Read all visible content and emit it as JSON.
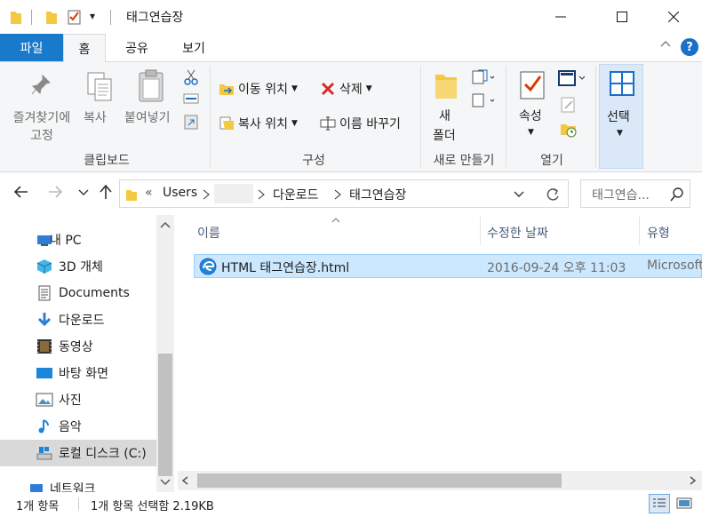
{
  "window": {
    "title": "태그연습장",
    "qat_dropdown": "▾"
  },
  "ribbon": {
    "tabs": [
      "파일",
      "홈",
      "공유",
      "보기"
    ],
    "clipboard": {
      "pin_label_1": "즐겨찾기에",
      "pin_label_2": "고정",
      "copy_label": "복사",
      "paste_label": "붙여넣기",
      "group_label": "클립보드"
    },
    "organize": {
      "move_to": "이동 위치",
      "copy_to": "복사 위치",
      "delete": "삭제",
      "rename": "이름 바꾸기",
      "group_label": "구성"
    },
    "new": {
      "new_folder_1": "새",
      "new_folder_2": "폴더",
      "group_label": "새로 만들기"
    },
    "open": {
      "properties": "속성",
      "group_label": "열기"
    },
    "select": {
      "label": "선택"
    }
  },
  "address": {
    "chevron_left": "«",
    "crumbs": [
      "Users",
      "다운로드",
      "태그연습장"
    ],
    "search_placeholder": "태그연습..."
  },
  "navpane": {
    "items": [
      {
        "label": "내 PC",
        "icon": "pc-icon"
      },
      {
        "label": "3D 개체",
        "icon": "3d-objects-icon"
      },
      {
        "label": "Documents",
        "icon": "documents-icon"
      },
      {
        "label": "다운로드",
        "icon": "download-icon"
      },
      {
        "label": "동영상",
        "icon": "videos-icon"
      },
      {
        "label": "바탕 화면",
        "icon": "desktop-icon"
      },
      {
        "label": "사진",
        "icon": "pictures-icon"
      },
      {
        "label": "음악",
        "icon": "music-icon"
      },
      {
        "label": "로컬 디스크 (C:)",
        "icon": "local-disk-icon"
      },
      {
        "label": "네트워크",
        "icon": "network-icon"
      }
    ]
  },
  "filelist": {
    "columns": {
      "name": "이름",
      "modified": "수정한 날짜",
      "type": "유형"
    },
    "rows": [
      {
        "name": "HTML 태그연습장.html",
        "modified": "2016-09-24 오후 11:03",
        "type": "Microsoft"
      }
    ]
  },
  "status": {
    "count": "1개 항목",
    "selection": "1개 항목 선택함 2.19KB"
  },
  "colors": {
    "accent": "#1979ca",
    "selection": "#cce8ff"
  }
}
